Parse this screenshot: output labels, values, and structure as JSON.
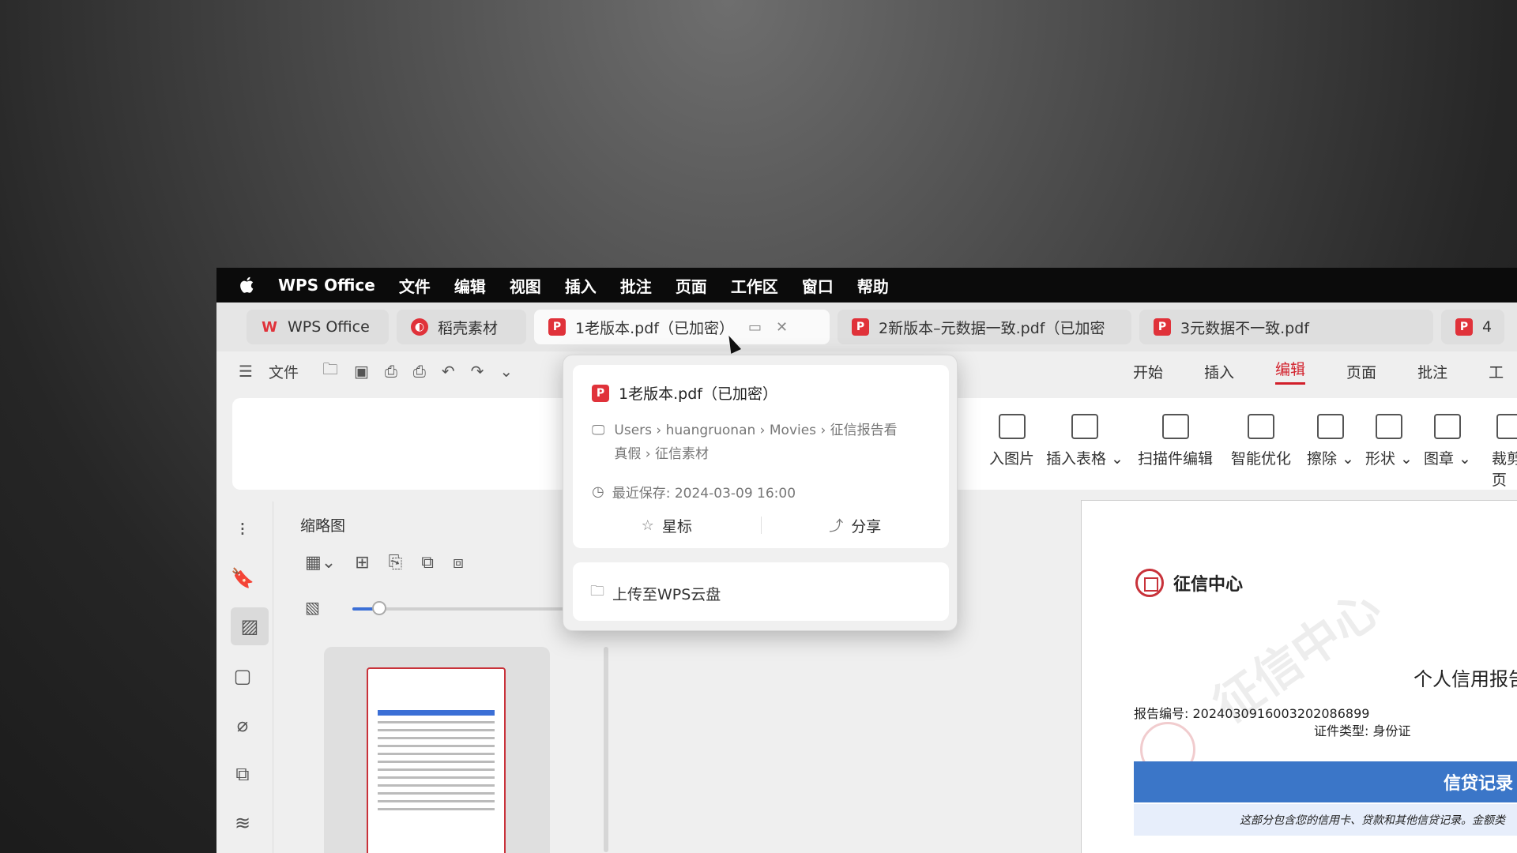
{
  "menubar": {
    "app": "WPS Office",
    "items": [
      "文件",
      "编辑",
      "视图",
      "插入",
      "批注",
      "页面",
      "工作区",
      "窗口",
      "帮助"
    ]
  },
  "tabs": [
    {
      "label": "WPS Office",
      "icon": "wps-logo-icon"
    },
    {
      "label": "稻壳素材",
      "icon": "docer-icon"
    },
    {
      "label": "1老版本.pdf（已加密）",
      "icon": "pdf-icon",
      "active": true
    },
    {
      "label": "2新版本–元数据一致.pdf（已加密",
      "icon": "pdf-icon"
    },
    {
      "label": "3元数据不一致.pdf",
      "icon": "pdf-icon"
    },
    {
      "label": "4",
      "icon": "pdf-icon"
    }
  ],
  "toolbar": {
    "file_label": "文件"
  },
  "ribbon_tabs": [
    "开始",
    "插入",
    "编辑",
    "页面",
    "批注",
    "工"
  ],
  "ribbon_buttons": [
    "入图片",
    "插入表格 ⌄",
    "扫描件编辑",
    "智能优化",
    "擦除 ⌄",
    "形状 ⌄",
    "图章 ⌄",
    "裁剪页"
  ],
  "thumbnails": {
    "title": "缩略图",
    "zoom_fraction": 0.12
  },
  "popup": {
    "title": "1老版本.pdf（已加密）",
    "path_line1": "Users › huangruonan › Movies › 征信报告看",
    "path_line2": "真假 › 征信素材",
    "saved": "最近保存: 2024-03-09 16:00",
    "star_label": "星标",
    "share_label": "分享",
    "upload_label": "上传至WPS云盘"
  },
  "document": {
    "logo_text": "征信中心",
    "heading": "个人信用报告",
    "report_no": "报告编号: 2024030916003202086899",
    "id_type": "证件类型:  身份证",
    "section": "信贷记录",
    "section_note": "这部分包含您的信用卡、贷款和其他信贷记录。金额类",
    "watermark": "征信中心"
  },
  "colors": {
    "accent": "#d21f2a",
    "doc_blue": "#3b76c8",
    "pdf_red": "#e0323a"
  }
}
